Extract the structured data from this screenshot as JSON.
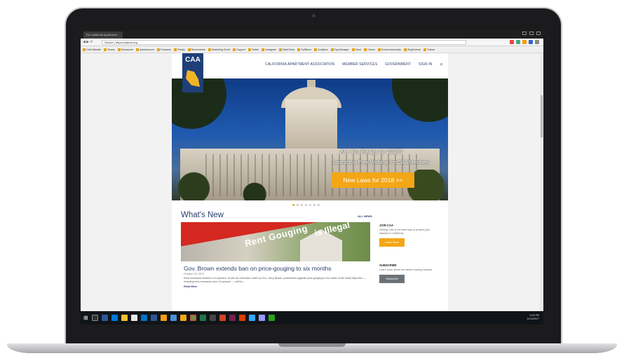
{
  "browser": {
    "tab_title": "The California Apartment...",
    "url": "Secure | https://caanet.org",
    "bookmarks": [
      "CAA Website",
      "Teams",
      "Sharepoint",
      "askofsoccom",
      "Podcasts",
      "Feedly",
      "Remembrise",
      "Marketing Cloud",
      "Support",
      "Twitter",
      "Instagram",
      "MailChimp",
      "SalRform",
      "Analytics",
      "Tag Manager",
      "Giant",
      "Canva",
      "Screencastomatic",
      "BlogCentral",
      "Trainer"
    ]
  },
  "site": {
    "logo_text": "CAA",
    "nav": {
      "items": [
        "CALIFORNIA APARTMENT ASSOCIATION",
        "MEMBER SERVICES",
        "GOVERNMENT",
        "SIGN IN"
      ]
    },
    "hero": {
      "headline": "Are You Ready for 2018?",
      "subline": "Attend this Free Webinar for CAA Members",
      "cta": "New Laws for 2018 >>",
      "slide_count": 7,
      "active_slide": 1
    },
    "whats_new": {
      "title": "What's New",
      "all_news": "ALL NEWS",
      "image_text_1": "Rent Gouging",
      "image_text_2": "is Illegal",
      "article": {
        "headline": "Gov. Brown extends ban on price-gouging to six months",
        "date": "October 09, 2017",
        "excerpt": "Rent increases limited to 10 percent. Under an executive order by Gov. Jerry Brown, protections against price gouging in the wake of the North Bay fires — including rent increases over 10 percent — will be...",
        "read_more": "Read More"
      }
    },
    "sidebar": {
      "join": {
        "title": "JOIN CAA",
        "text": "Joining CAA is the best way to protect your industry in California.",
        "button": "Learn More"
      },
      "subscribe": {
        "title": "SUBSCRIBE",
        "text": "Learn more about the latest housing industry",
        "button": "Subscribe"
      }
    }
  },
  "taskbar": {
    "time": "6:20 PM",
    "date": "11/13/2017"
  },
  "colors": {
    "brand_navy": "#2a3f6b",
    "accent_orange": "#f3a616",
    "alert_red": "#d42820"
  }
}
